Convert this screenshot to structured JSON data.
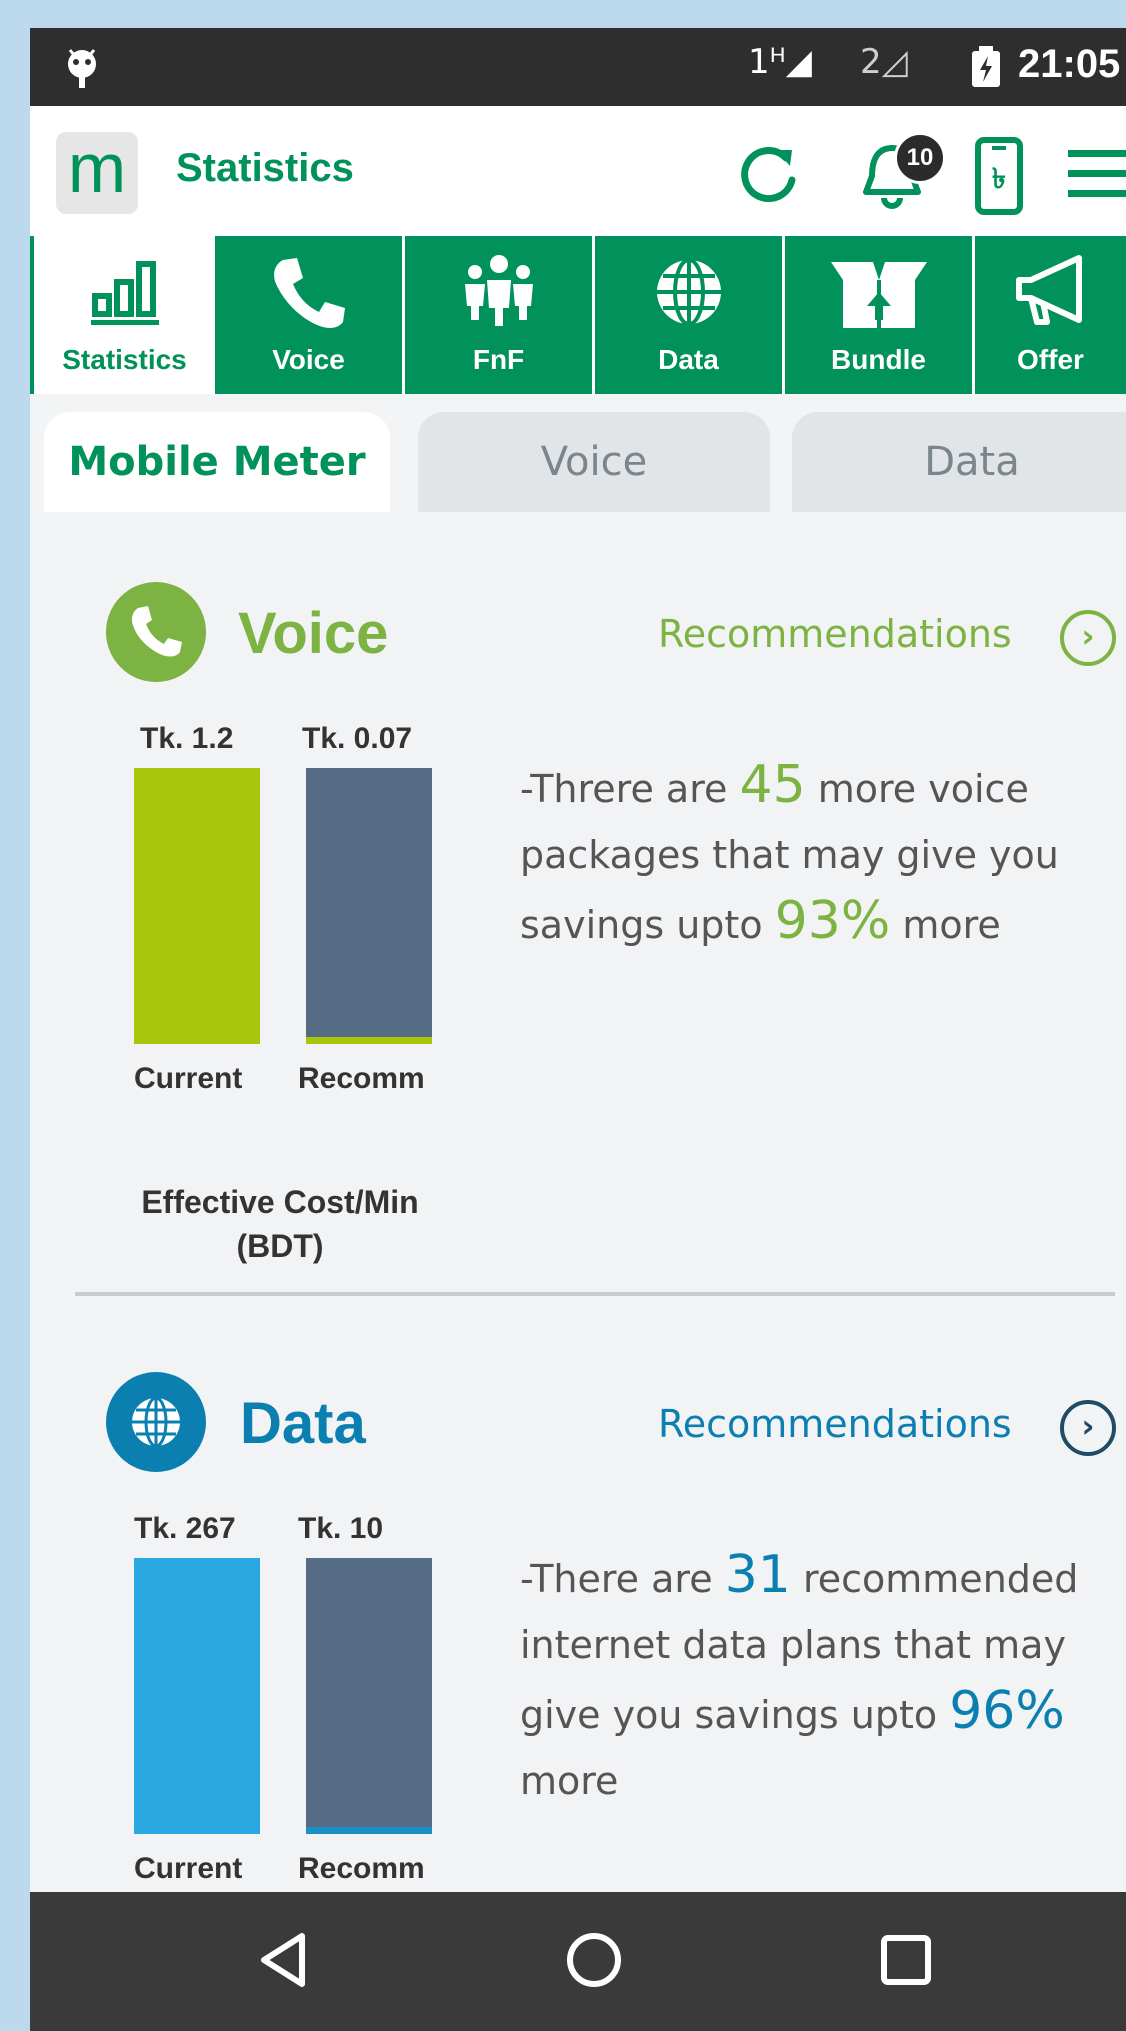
{
  "status_bar": {
    "sim1": "1ᴴ◢",
    "sim2": "2◿",
    "time": "21:05"
  },
  "app_bar": {
    "logo": "m",
    "title": "Statistics",
    "notification_count": "10",
    "icons": [
      "refresh-icon",
      "bell-icon",
      "phone-taka-icon",
      "menu-icon"
    ]
  },
  "nav_tabs": [
    {
      "label": "Statistics",
      "icon": "bar-chart-icon",
      "active": true
    },
    {
      "label": "Voice",
      "icon": "phone-icon"
    },
    {
      "label": "FnF",
      "icon": "people-icon"
    },
    {
      "label": "Data",
      "icon": "globe-icon"
    },
    {
      "label": "Bundle",
      "icon": "box-icon"
    },
    {
      "label": "Offer",
      "icon": "megaphone-icon"
    }
  ],
  "sub_tabs": [
    {
      "label": "Mobile Meter",
      "active": true
    },
    {
      "label": "Voice"
    },
    {
      "label": "Data"
    }
  ],
  "voice": {
    "title": "Voice",
    "recommendations": "Recommendations",
    "current_value_label": "Tk. 1.2",
    "recomm_value_label": "Tk. 0.07",
    "current_label": "Current",
    "recomm_label": "Recomm",
    "caption_line1": "Effective Cost/Min",
    "caption_line2": "(BDT)",
    "desc_pre": "-Threre are",
    "desc_num": "45",
    "desc_mid": "more voice packages that may give you savings upto",
    "desc_pct": "93%",
    "desc_post": "more",
    "current_value": 1.2,
    "recomm_value": 0.07,
    "colors": {
      "accent": "#7cb342",
      "current_bar": "#a8c70c",
      "recomm_bar": "#566b84"
    }
  },
  "data": {
    "title": "Data",
    "recommendations": "Recommendations",
    "current_value_label": "Tk. 267",
    "recomm_value_label": "Tk. 10",
    "current_label": "Current",
    "recomm_label": "Recomm",
    "desc_pre": "-There are",
    "desc_num": "31",
    "desc_mid": "recommended internet data plans that may give you savings upto",
    "desc_pct": "96%",
    "desc_post": "more",
    "current_value": 267,
    "recomm_value": 10,
    "colors": {
      "accent": "#0a7fb0",
      "current_bar": "#2aa7de",
      "recomm_bar": "#566b84"
    }
  },
  "colors": {
    "brand": "#00925a"
  }
}
